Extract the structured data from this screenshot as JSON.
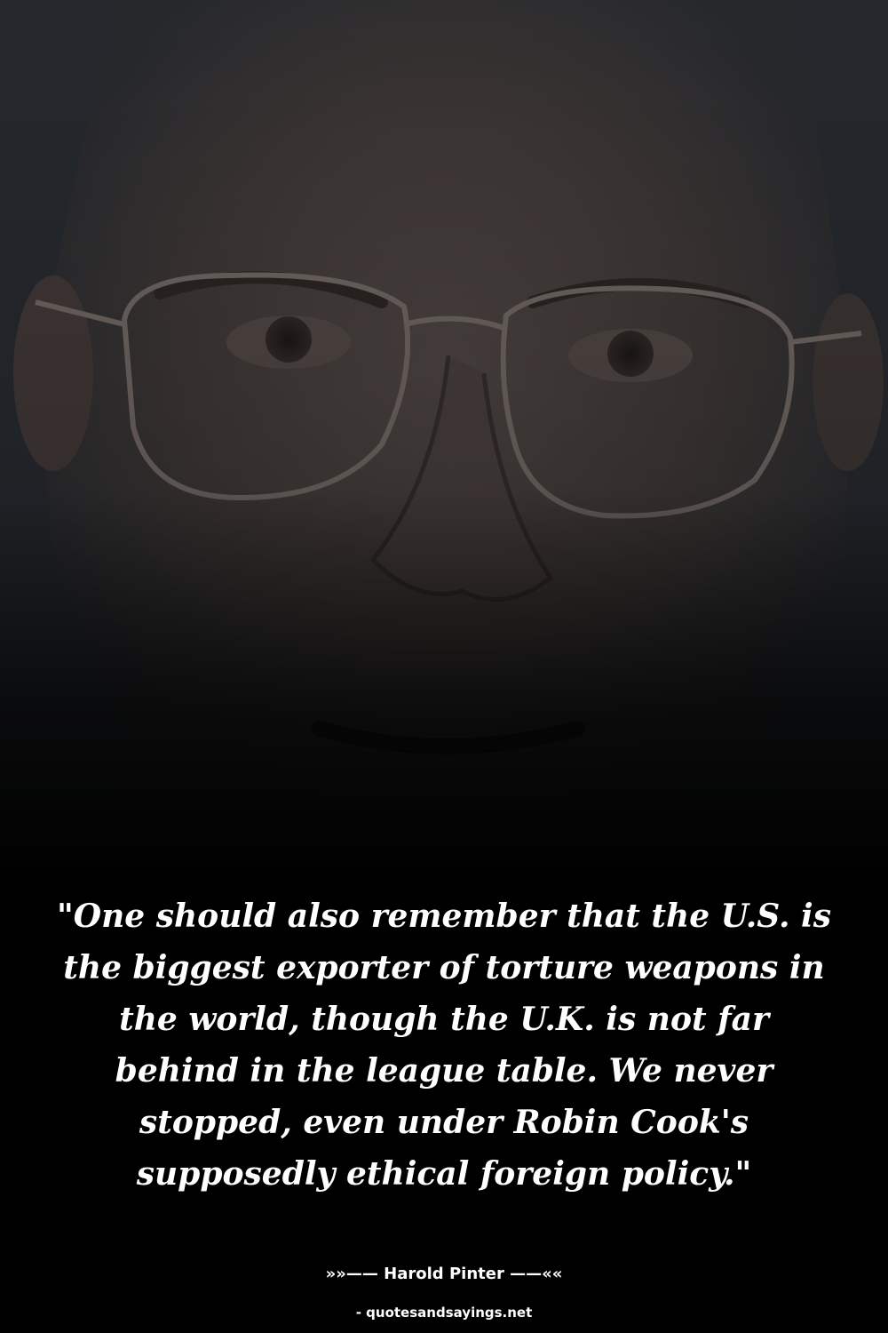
{
  "quote": {
    "text": "\"One should also remember that the U.S. is the biggest exporter of torture weapons in the world, though the U.K. is not far behind in the league table. We never stopped, even under Robin Cook's supposedly ethical foreign policy.\""
  },
  "attribution": {
    "author_line": "»»—— Harold Pinter ——««",
    "source": "- quotesandsayings.net"
  },
  "colors": {
    "background": "#000000",
    "text": "#ffffff"
  }
}
